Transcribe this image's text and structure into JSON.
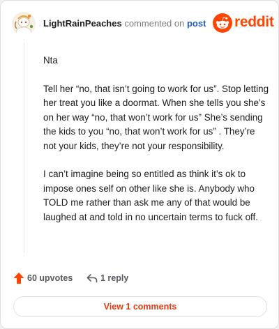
{
  "comment": {
    "username": "LightRainPeaches",
    "action_text": "commented on",
    "target_label": "post",
    "paragraphs": [
      "Nta",
      "Tell her “no, that isn’t going to work for us”. Stop letting her treat you like a doormat. When she tells you she’s on her way “no, that won’t work for us” She’s sending the kids to you “no, that won’t work for us” . They’re not your kids, they’re not your responsibility.",
      "I can’t imagine being so entitled as think it’s ok to impose ones self on other like she is. Anybody who TOLD me rather than ask me any of that would be laughed at and told in no uncertain terms to fuck off."
    ]
  },
  "brand": {
    "name": "reddit",
    "icon": "reddit-snoo-icon",
    "color": "#ff4500"
  },
  "actions": {
    "upvotes_label": "60 upvotes",
    "upvote_icon": "upvote-arrow-icon",
    "upvote_color": "#ff4500",
    "reply_label": "1 reply",
    "reply_icon": "reply-arrow-icon"
  },
  "footer": {
    "view_comments_label": "View 1 comments"
  },
  "colors": {
    "link": "#1f5fbf",
    "accent": "#e8390e"
  }
}
